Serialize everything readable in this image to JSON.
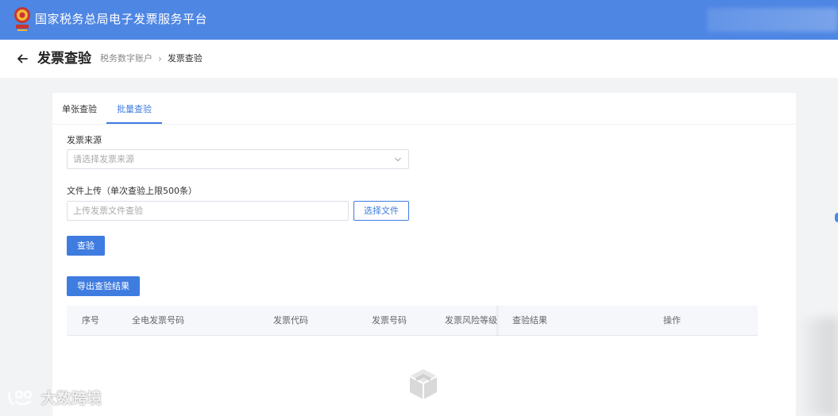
{
  "header": {
    "site_title": "国家税务总局电子发票服务平台",
    "emblem_icon": "tax-emblem-icon",
    "brand_color": "#4e86e4"
  },
  "page": {
    "title": "发票查验",
    "back_icon": "arrow-left-icon",
    "breadcrumb": {
      "parent": "税务数字账户",
      "separator": "›",
      "current": "发票查验"
    }
  },
  "tabs": [
    {
      "label": "单张查验",
      "active": false
    },
    {
      "label": "批量查验",
      "active": true
    }
  ],
  "form": {
    "source_label": "发票来源",
    "source_placeholder": "请选择发票来源",
    "upload_label": "文件上传（单次查验上限500条）",
    "upload_placeholder": "上传发票文件查验",
    "choose_file_label": "选择文件",
    "verify_label": "查验",
    "export_label": "导出查验结果"
  },
  "table": {
    "columns": [
      "序号",
      "全电发票号码",
      "发票代码",
      "发票号码",
      "发票风险等级",
      "查验结果",
      "操作"
    ],
    "empty_icon": "empty-box-icon"
  },
  "watermark": {
    "text": "大数跨境"
  },
  "colors": {
    "accent": "#3f7ce0"
  }
}
